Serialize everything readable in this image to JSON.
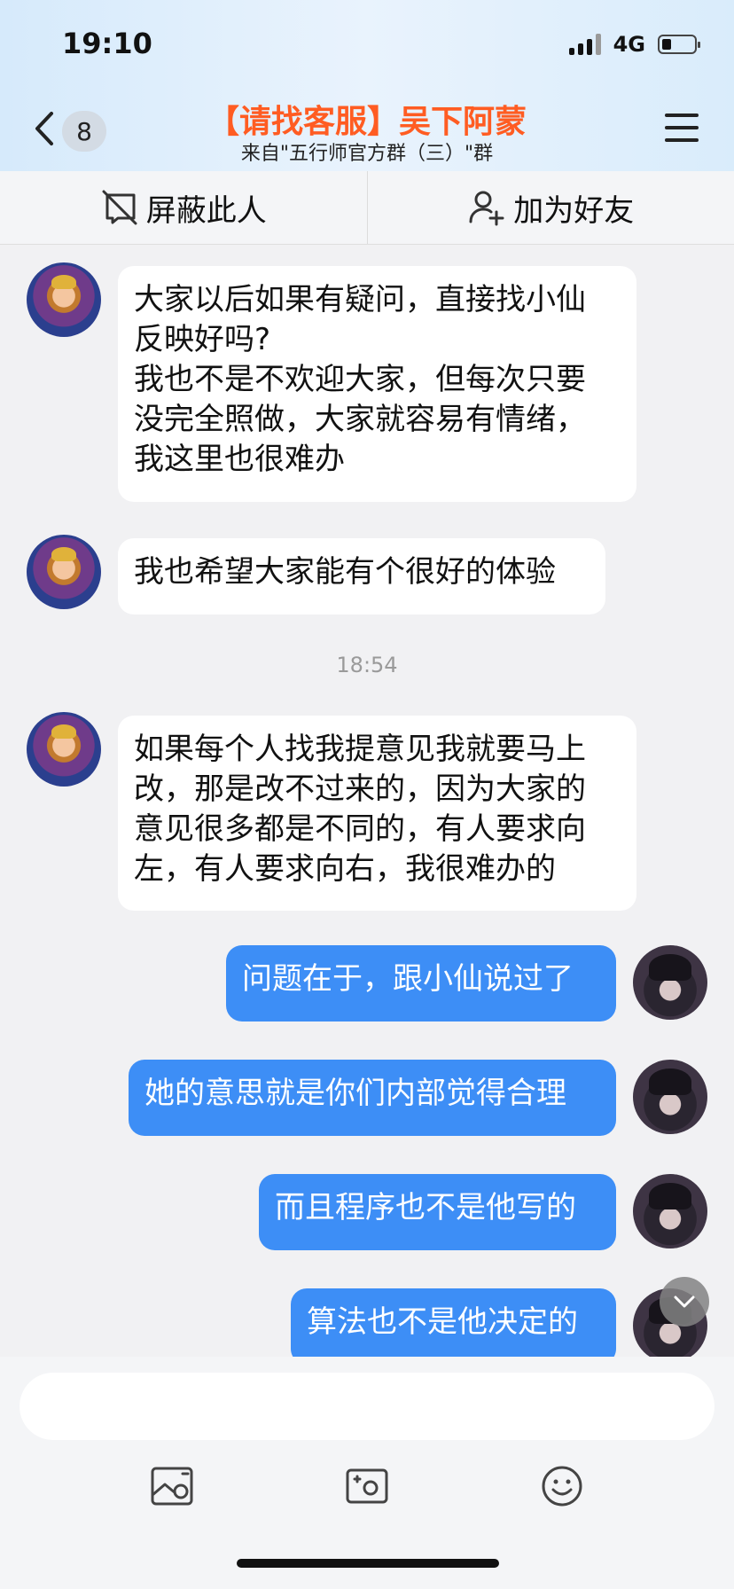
{
  "status_bar": {
    "time": "19:10",
    "network": "4G",
    "signal_bars": 3,
    "battery_level": 0.3
  },
  "header": {
    "back_badge": "8",
    "title": "【请找客服】吴下阿蒙",
    "subtitle": "来自\"五行师官方群（三）\"群"
  },
  "actions": {
    "block_label": "屏蔽此人",
    "add_friend_label": "加为好友"
  },
  "messages": [
    {
      "side": "left",
      "text": "大家以后如果有疑问，直接找小仙\n反映好吗?\n我也不是不欢迎大家，但每次只要\n没完全照做，大家就容易有情绪，\n我这里也很难办"
    },
    {
      "side": "left",
      "text": "我也希望大家能有个很好的体验"
    },
    {
      "time": "18:54"
    },
    {
      "side": "left",
      "text": "如果每个人找我提意见我就要马上\n改，那是改不过来的，因为大家的\n意见很多都是不同的，有人要求向\n左，有人要求向右，我很难办的"
    },
    {
      "side": "right",
      "text": "问题在于，跟小仙说过了"
    },
    {
      "side": "right",
      "text": "她的意思就是你们内部觉得合理"
    },
    {
      "side": "right",
      "text": "而且程序也不是他写的"
    },
    {
      "side": "right",
      "text": "算法也不是他决定的"
    }
  ],
  "input": {
    "placeholder": ""
  },
  "icons": {
    "back": "chevron-left-icon",
    "menu": "hamburger-menu-icon",
    "block": "block-user-icon",
    "add_friend": "add-user-icon",
    "image": "image-icon",
    "camera": "camera-icon",
    "emoji": "emoji-icon",
    "scroll_down": "chevron-down-icon"
  },
  "colors": {
    "title": "#ff5c22",
    "sent_bubble": "#3d8ef6",
    "received_bubble": "#ffffff"
  }
}
